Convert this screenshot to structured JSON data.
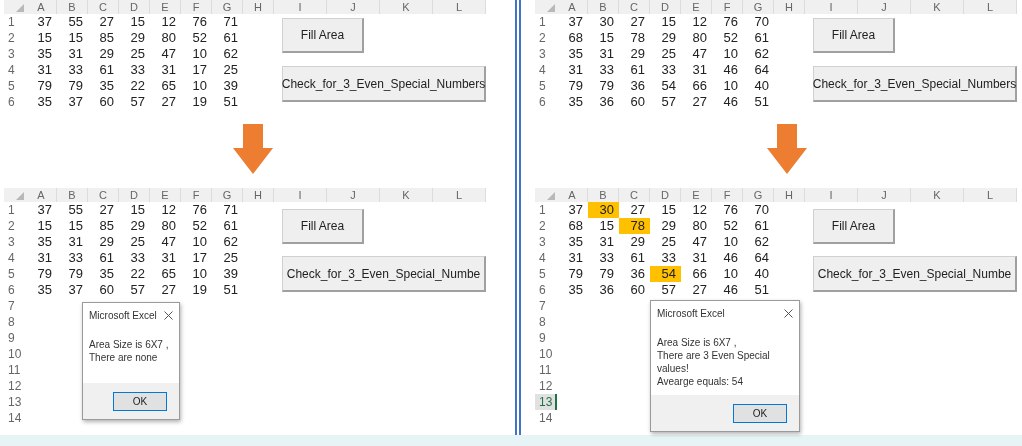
{
  "panels": [
    {
      "sheets": [
        {
          "columns": [
            "A",
            "B",
            "C",
            "D",
            "E",
            "F",
            "G",
            "H",
            "I",
            "J",
            "K",
            "L"
          ],
          "rows": [
            {
              "number": "1",
              "selected": false,
              "cells": [
                {
                  "value": "37",
                  "highlighted": false
                },
                {
                  "value": "55",
                  "highlighted": false
                },
                {
                  "value": "27",
                  "highlighted": false
                },
                {
                  "value": "15",
                  "highlighted": false
                },
                {
                  "value": "12",
                  "highlighted": false
                },
                {
                  "value": "76",
                  "highlighted": false
                },
                {
                  "value": "71",
                  "highlighted": false
                }
              ]
            },
            {
              "number": "2",
              "selected": false,
              "cells": [
                {
                  "value": "15",
                  "highlighted": false
                },
                {
                  "value": "15",
                  "highlighted": false
                },
                {
                  "value": "85",
                  "highlighted": false
                },
                {
                  "value": "29",
                  "highlighted": false
                },
                {
                  "value": "80",
                  "highlighted": false
                },
                {
                  "value": "52",
                  "highlighted": false
                },
                {
                  "value": "61",
                  "highlighted": false
                }
              ]
            },
            {
              "number": "3",
              "selected": false,
              "cells": [
                {
                  "value": "35",
                  "highlighted": false
                },
                {
                  "value": "31",
                  "highlighted": false
                },
                {
                  "value": "29",
                  "highlighted": false
                },
                {
                  "value": "25",
                  "highlighted": false
                },
                {
                  "value": "47",
                  "highlighted": false
                },
                {
                  "value": "10",
                  "highlighted": false
                },
                {
                  "value": "62",
                  "highlighted": false
                }
              ]
            },
            {
              "number": "4",
              "selected": false,
              "cells": [
                {
                  "value": "31",
                  "highlighted": false
                },
                {
                  "value": "33",
                  "highlighted": false
                },
                {
                  "value": "61",
                  "highlighted": false
                },
                {
                  "value": "33",
                  "highlighted": false
                },
                {
                  "value": "31",
                  "highlighted": false
                },
                {
                  "value": "17",
                  "highlighted": false
                },
                {
                  "value": "25",
                  "highlighted": false
                }
              ]
            },
            {
              "number": "5",
              "selected": false,
              "cells": [
                {
                  "value": "79",
                  "highlighted": false
                },
                {
                  "value": "79",
                  "highlighted": false
                },
                {
                  "value": "35",
                  "highlighted": false
                },
                {
                  "value": "22",
                  "highlighted": false
                },
                {
                  "value": "65",
                  "highlighted": false
                },
                {
                  "value": "10",
                  "highlighted": false
                },
                {
                  "value": "39",
                  "highlighted": false
                }
              ]
            },
            {
              "number": "6",
              "selected": false,
              "cells": [
                {
                  "value": "35",
                  "highlighted": false
                },
                {
                  "value": "37",
                  "highlighted": false
                },
                {
                  "value": "60",
                  "highlighted": false
                },
                {
                  "value": "57",
                  "highlighted": false
                },
                {
                  "value": "27",
                  "highlighted": false
                },
                {
                  "value": "19",
                  "highlighted": false
                },
                {
                  "value": "51",
                  "highlighted": false
                }
              ]
            }
          ],
          "buttons": [
            "Fill Area",
            "Check_for_3_Even_Special_Numbers"
          ]
        },
        {
          "columns": [
            "A",
            "B",
            "C",
            "D",
            "E",
            "F",
            "G",
            "H",
            "I",
            "J",
            "K",
            "L"
          ],
          "rows": [
            {
              "number": "1",
              "selected": false,
              "cells": [
                {
                  "value": "37",
                  "highlighted": false
                },
                {
                  "value": "55",
                  "highlighted": false
                },
                {
                  "value": "27",
                  "highlighted": false
                },
                {
                  "value": "15",
                  "highlighted": false
                },
                {
                  "value": "12",
                  "highlighted": false
                },
                {
                  "value": "76",
                  "highlighted": false
                },
                {
                  "value": "71",
                  "highlighted": false
                }
              ]
            },
            {
              "number": "2",
              "selected": false,
              "cells": [
                {
                  "value": "15",
                  "highlighted": false
                },
                {
                  "value": "15",
                  "highlighted": false
                },
                {
                  "value": "85",
                  "highlighted": false
                },
                {
                  "value": "29",
                  "highlighted": false
                },
                {
                  "value": "80",
                  "highlighted": false
                },
                {
                  "value": "52",
                  "highlighted": false
                },
                {
                  "value": "61",
                  "highlighted": false
                }
              ]
            },
            {
              "number": "3",
              "selected": false,
              "cells": [
                {
                  "value": "35",
                  "highlighted": false
                },
                {
                  "value": "31",
                  "highlighted": false
                },
                {
                  "value": "29",
                  "highlighted": false
                },
                {
                  "value": "25",
                  "highlighted": false
                },
                {
                  "value": "47",
                  "highlighted": false
                },
                {
                  "value": "10",
                  "highlighted": false
                },
                {
                  "value": "62",
                  "highlighted": false
                }
              ]
            },
            {
              "number": "4",
              "selected": false,
              "cells": [
                {
                  "value": "31",
                  "highlighted": false
                },
                {
                  "value": "33",
                  "highlighted": false
                },
                {
                  "value": "61",
                  "highlighted": false
                },
                {
                  "value": "33",
                  "highlighted": false
                },
                {
                  "value": "31",
                  "highlighted": false
                },
                {
                  "value": "17",
                  "highlighted": false
                },
                {
                  "value": "25",
                  "highlighted": false
                }
              ]
            },
            {
              "number": "5",
              "selected": false,
              "cells": [
                {
                  "value": "79",
                  "highlighted": false
                },
                {
                  "value": "79",
                  "highlighted": false
                },
                {
                  "value": "35",
                  "highlighted": false
                },
                {
                  "value": "22",
                  "highlighted": false
                },
                {
                  "value": "65",
                  "highlighted": false
                },
                {
                  "value": "10",
                  "highlighted": false
                },
                {
                  "value": "39",
                  "highlighted": false
                }
              ]
            },
            {
              "number": "6",
              "selected": false,
              "cells": [
                {
                  "value": "35",
                  "highlighted": false
                },
                {
                  "value": "37",
                  "highlighted": false
                },
                {
                  "value": "60",
                  "highlighted": false
                },
                {
                  "value": "57",
                  "highlighted": false
                },
                {
                  "value": "27",
                  "highlighted": false
                },
                {
                  "value": "19",
                  "highlighted": false
                },
                {
                  "value": "51",
                  "highlighted": false
                }
              ]
            },
            {
              "number": "7",
              "selected": false
            },
            {
              "number": "8",
              "selected": false
            },
            {
              "number": "9",
              "selected": false
            },
            {
              "number": "10",
              "selected": false
            },
            {
              "number": "11",
              "selected": false
            },
            {
              "number": "12",
              "selected": false
            },
            {
              "number": "13",
              "selected": false
            },
            {
              "number": "14",
              "selected": false
            }
          ],
          "buttons": [
            "Fill Area",
            "Check_for_3_Even_Special_Numbe"
          ],
          "dialog": {
            "title": "Microsoft Excel",
            "message_lines": [
              "Area Size is 6X7 ,",
              "There are none"
            ],
            "button": "OK"
          }
        }
      ]
    },
    {
      "sheets": [
        {
          "columns": [
            "A",
            "B",
            "C",
            "D",
            "E",
            "F",
            "G",
            "H",
            "I",
            "J",
            "K",
            "L"
          ],
          "rows": [
            {
              "number": "1",
              "selected": false,
              "cells": [
                {
                  "value": "37",
                  "highlighted": false
                },
                {
                  "value": "30",
                  "highlighted": false
                },
                {
                  "value": "27",
                  "highlighted": false
                },
                {
                  "value": "15",
                  "highlighted": false
                },
                {
                  "value": "12",
                  "highlighted": false
                },
                {
                  "value": "76",
                  "highlighted": false
                },
                {
                  "value": "70",
                  "highlighted": false
                }
              ]
            },
            {
              "number": "2",
              "selected": false,
              "cells": [
                {
                  "value": "68",
                  "highlighted": false
                },
                {
                  "value": "15",
                  "highlighted": false
                },
                {
                  "value": "78",
                  "highlighted": false
                },
                {
                  "value": "29",
                  "highlighted": false
                },
                {
                  "value": "80",
                  "highlighted": false
                },
                {
                  "value": "52",
                  "highlighted": false
                },
                {
                  "value": "61",
                  "highlighted": false
                }
              ]
            },
            {
              "number": "3",
              "selected": false,
              "cells": [
                {
                  "value": "35",
                  "highlighted": false
                },
                {
                  "value": "31",
                  "highlighted": false
                },
                {
                  "value": "29",
                  "highlighted": false
                },
                {
                  "value": "25",
                  "highlighted": false
                },
                {
                  "value": "47",
                  "highlighted": false
                },
                {
                  "value": "10",
                  "highlighted": false
                },
                {
                  "value": "62",
                  "highlighted": false
                }
              ]
            },
            {
              "number": "4",
              "selected": false,
              "cells": [
                {
                  "value": "31",
                  "highlighted": false
                },
                {
                  "value": "33",
                  "highlighted": false
                },
                {
                  "value": "61",
                  "highlighted": false
                },
                {
                  "value": "33",
                  "highlighted": false
                },
                {
                  "value": "31",
                  "highlighted": false
                },
                {
                  "value": "46",
                  "highlighted": false
                },
                {
                  "value": "64",
                  "highlighted": false
                }
              ]
            },
            {
              "number": "5",
              "selected": false,
              "cells": [
                {
                  "value": "79",
                  "highlighted": false
                },
                {
                  "value": "79",
                  "highlighted": false
                },
                {
                  "value": "36",
                  "highlighted": false
                },
                {
                  "value": "54",
                  "highlighted": false
                },
                {
                  "value": "66",
                  "highlighted": false
                },
                {
                  "value": "10",
                  "highlighted": false
                },
                {
                  "value": "40",
                  "highlighted": false
                }
              ]
            },
            {
              "number": "6",
              "selected": false,
              "cells": [
                {
                  "value": "35",
                  "highlighted": false
                },
                {
                  "value": "36",
                  "highlighted": false
                },
                {
                  "value": "60",
                  "highlighted": false
                },
                {
                  "value": "57",
                  "highlighted": false
                },
                {
                  "value": "27",
                  "highlighted": false
                },
                {
                  "value": "46",
                  "highlighted": false
                },
                {
                  "value": "51",
                  "highlighted": false
                }
              ]
            }
          ],
          "buttons": [
            "Fill Area",
            "Check_for_3_Even_Special_Numbers"
          ]
        },
        {
          "columns": [
            "A",
            "B",
            "C",
            "D",
            "E",
            "F",
            "G",
            "H",
            "I",
            "J",
            "K",
            "L"
          ],
          "rows": [
            {
              "number": "1",
              "selected": false,
              "cells": [
                {
                  "value": "37",
                  "highlighted": false
                },
                {
                  "value": "30",
                  "highlighted": true
                },
                {
                  "value": "27",
                  "highlighted": false
                },
                {
                  "value": "15",
                  "highlighted": false
                },
                {
                  "value": "12",
                  "highlighted": false
                },
                {
                  "value": "76",
                  "highlighted": false
                },
                {
                  "value": "70",
                  "highlighted": false
                }
              ]
            },
            {
              "number": "2",
              "selected": false,
              "cells": [
                {
                  "value": "68",
                  "highlighted": false
                },
                {
                  "value": "15",
                  "highlighted": false
                },
                {
                  "value": "78",
                  "highlighted": true
                },
                {
                  "value": "29",
                  "highlighted": false
                },
                {
                  "value": "80",
                  "highlighted": false
                },
                {
                  "value": "52",
                  "highlighted": false
                },
                {
                  "value": "61",
                  "highlighted": false
                }
              ]
            },
            {
              "number": "3",
              "selected": false,
              "cells": [
                {
                  "value": "35",
                  "highlighted": false
                },
                {
                  "value": "31",
                  "highlighted": false
                },
                {
                  "value": "29",
                  "highlighted": false
                },
                {
                  "value": "25",
                  "highlighted": false
                },
                {
                  "value": "47",
                  "highlighted": false
                },
                {
                  "value": "10",
                  "highlighted": false
                },
                {
                  "value": "62",
                  "highlighted": false
                }
              ]
            },
            {
              "number": "4",
              "selected": false,
              "cells": [
                {
                  "value": "31",
                  "highlighted": false
                },
                {
                  "value": "33",
                  "highlighted": false
                },
                {
                  "value": "61",
                  "highlighted": false
                },
                {
                  "value": "33",
                  "highlighted": false
                },
                {
                  "value": "31",
                  "highlighted": false
                },
                {
                  "value": "46",
                  "highlighted": false
                },
                {
                  "value": "64",
                  "highlighted": false
                }
              ]
            },
            {
              "number": "5",
              "selected": false,
              "cells": [
                {
                  "value": "79",
                  "highlighted": false
                },
                {
                  "value": "79",
                  "highlighted": false
                },
                {
                  "value": "36",
                  "highlighted": false
                },
                {
                  "value": "54",
                  "highlighted": true
                },
                {
                  "value": "66",
                  "highlighted": false
                },
                {
                  "value": "10",
                  "highlighted": false
                },
                {
                  "value": "40",
                  "highlighted": false
                }
              ]
            },
            {
              "number": "6",
              "selected": false,
              "cells": [
                {
                  "value": "35",
                  "highlighted": false
                },
                {
                  "value": "36",
                  "highlighted": false
                },
                {
                  "value": "60",
                  "highlighted": false
                },
                {
                  "value": "57",
                  "highlighted": false
                },
                {
                  "value": "27",
                  "highlighted": false
                },
                {
                  "value": "46",
                  "highlighted": false
                },
                {
                  "value": "51",
                  "highlighted": false
                }
              ]
            },
            {
              "number": "7",
              "selected": false
            },
            {
              "number": "8",
              "selected": false
            },
            {
              "number": "9",
              "selected": false
            },
            {
              "number": "10",
              "selected": false
            },
            {
              "number": "11",
              "selected": false
            },
            {
              "number": "12",
              "selected": false
            },
            {
              "number": "13",
              "selected": true
            },
            {
              "number": "14",
              "selected": false
            }
          ],
          "buttons": [
            "Fill Area",
            "Check_for_3_Even_Special_Numbe"
          ],
          "dialog": {
            "title": "Microsoft Excel",
            "message_lines": [
              "Area Size is 6X7 ,",
              "There are 3 Even Special values!",
              "Avearge equals: 54"
            ],
            "button": "OK"
          }
        }
      ]
    }
  ]
}
